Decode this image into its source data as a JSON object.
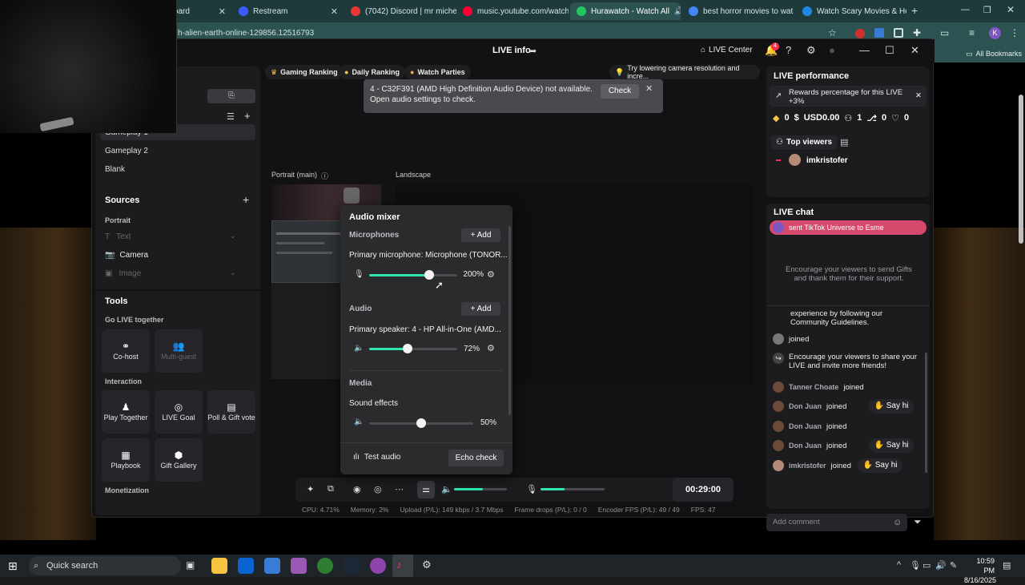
{
  "browser": {
    "tabs": [
      {
        "label": "Dashboard",
        "color": "#3a7bd5"
      },
      {
        "label": "Restream",
        "color": "#3d5afe"
      },
      {
        "label": "(7042) Discord | mr miche",
        "color": "#e53935"
      },
      {
        "label": "music.youtube.com/watch",
        "color": "#ff0033"
      },
      {
        "label": "Hurawatch - Watch All",
        "color": "#22c55e"
      },
      {
        "label": "best horror movies to wat",
        "color": "#4285f4"
      },
      {
        "label": "Watch Scary Movies & Ho",
        "color": "#1e88e5"
      }
    ],
    "url": "h-alien-earth-online-129856.12516793",
    "bookmarks_label": "All Bookmarks"
  },
  "app": {
    "title": "LIVE info",
    "live_center": "LIVE Center",
    "notification_count": "4"
  },
  "left": {
    "scenes": [
      "Gameplay 1",
      "Gameplay 2",
      "Blank"
    ],
    "sources_title": "Sources",
    "portrait_label": "Portrait",
    "source_items": [
      "Text",
      "Camera",
      "Image"
    ],
    "tools_title": "Tools",
    "go_live_together": "Go LIVE together",
    "cohost": "Co-host",
    "multiguest": "Multi-guest",
    "interaction": "Interaction",
    "play_together": "Play Together",
    "live_goal": "LIVE Goal",
    "poll_vote": "Poll & Gift vote",
    "playbook": "Playbook",
    "gift_gallery": "Gift Gallery",
    "monetization": "Monetization"
  },
  "center": {
    "chips": [
      "Gaming Ranking",
      "Daily Ranking",
      "Watch Parties"
    ],
    "tip": "Try lowering camera resolution and incre...",
    "alert_text": "4 - C32F391 (AMD High Definition Audio Device) not available. Open audio settings to check.",
    "alert_check": "Check",
    "portrait_label": "Portrait (main)",
    "landscape_label": "Landscape",
    "timer": "00:29:00",
    "stats": [
      "CPU: 4.71%",
      "Memory: 2%",
      "Upload (P/L): 149 kbps / 3.7 Mbps",
      "Frame drops (P/L): 0 / 0",
      "Encoder FPS (P/L): 49 / 49",
      "FPS: 47"
    ]
  },
  "mixer": {
    "title": "Audio mixer",
    "microphones": "Microphones",
    "add": "+ Add",
    "mic_label": "Primary microphone: Microphone (TONOR...",
    "mic_pct": "200%",
    "mic_level": 0.68,
    "audio": "Audio",
    "speaker_label": "Primary speaker: 4 - HP All-in-One (AMD...",
    "speaker_pct": "72%",
    "speaker_level": 0.44,
    "media": "Media",
    "sound_effects": "Sound effects",
    "sfx_pct": "50%",
    "sfx_level": 0.5,
    "test_audio": "Test audio",
    "echo_check": "Echo check",
    "accent": "#2ee6b0"
  },
  "right": {
    "performance_title": "LIVE performance",
    "rewards": "Rewards percentage for this LIVE +3%",
    "metrics": {
      "diamonds": "0",
      "usd": "USD0.00",
      "viewers": "1",
      "shares": "0",
      "likes": "0"
    },
    "top_viewers": "Top viewers",
    "top_viewer_name": "imkristofer",
    "chat_title": "LIVE chat",
    "gift_banner": "sent TikTok Universe to",
    "gift_target": "Esme",
    "encourage_gifts": "Encourage your viewers to send Gifts and thank them for their support.",
    "guidelines": "experience by following our Community Guidelines.",
    "joined": "joined",
    "encourage_share": "Encourage your viewers to share your LIVE and invite more friends!",
    "users": [
      "Tanner Choate",
      "Don Juan",
      "Don Juan",
      "Don Juan",
      "imkristofer"
    ],
    "sayhi": "Say hi",
    "add_comment": "Add comment"
  },
  "taskbar": {
    "search": "Quick search",
    "time": "10:59 PM",
    "date": "8/16/2025"
  }
}
